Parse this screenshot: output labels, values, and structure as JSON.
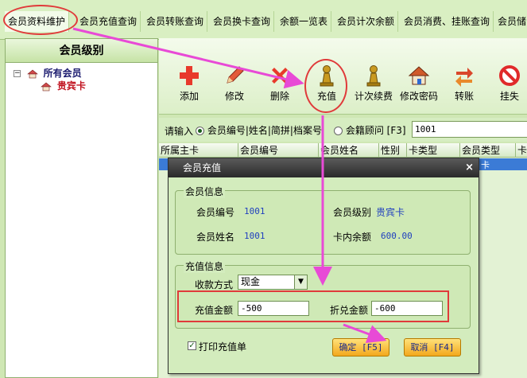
{
  "tabs": [
    "会员资料维护",
    "会员充值查询",
    "会员转账查询",
    "会员换卡查询",
    "余额一览表",
    "会员计次余额",
    "会员消费、挂账查询",
    "会员储"
  ],
  "left_panel": {
    "title": "会员级别",
    "tree": [
      {
        "label": "所有会员",
        "expander": "−"
      },
      {
        "label": "贵宾卡"
      }
    ]
  },
  "toolbar": {
    "buttons": [
      {
        "label": "添加",
        "icon": "plus-icon",
        "color": "#e8392b"
      },
      {
        "label": "修改",
        "icon": "pencil-icon",
        "color": "#d9472b"
      },
      {
        "label": "删除",
        "icon": "delete-x-icon",
        "color": "#e8392b"
      },
      {
        "label": "充值",
        "icon": "chess-pawn-icon",
        "color": "#c99a21"
      },
      {
        "label": "计次续费",
        "icon": "chess-pawn-icon",
        "color": "#c99a21"
      },
      {
        "label": "修改密码",
        "icon": "house-icon",
        "color": "#d05a2a"
      },
      {
        "label": "转账",
        "icon": "transfer-icon",
        "color": "#d9472b"
      },
      {
        "label": "挂失",
        "icon": "no-entry-icon",
        "color": "#e02a2a"
      }
    ]
  },
  "search": {
    "prompt": "请输入",
    "option1": "会员编号|姓名|简拼|档案号",
    "option2": "会籍顾问 [F3]",
    "value": "1001"
  },
  "grid": {
    "columns": [
      "所属主卡",
      "会员编号",
      "会员姓名",
      "性别",
      "卡类型",
      "会员类型",
      "卡"
    ],
    "selected_row_tail": "卡"
  },
  "dialog": {
    "title": "会员充值",
    "close": "×",
    "member_info": {
      "legend": "会员信息",
      "id_label": "会员编号",
      "id_value": "1001",
      "level_label": "会员级别",
      "level_value": "贵宾卡",
      "name_label": "会员姓名",
      "name_value": "1001",
      "balance_label": "卡内余额",
      "balance_value": "600.00"
    },
    "recharge_info": {
      "legend": "充值信息",
      "method_label": "收款方式",
      "method_value": "现金",
      "amount_label": "充值金额",
      "amount_value": "-500",
      "discount_label": "折兑金额",
      "discount_value": "-600"
    },
    "print_label": "打印充值单",
    "print_checked": "✓",
    "ok_label": "确定 [F5]",
    "cancel_label": "取消 [F4]"
  }
}
